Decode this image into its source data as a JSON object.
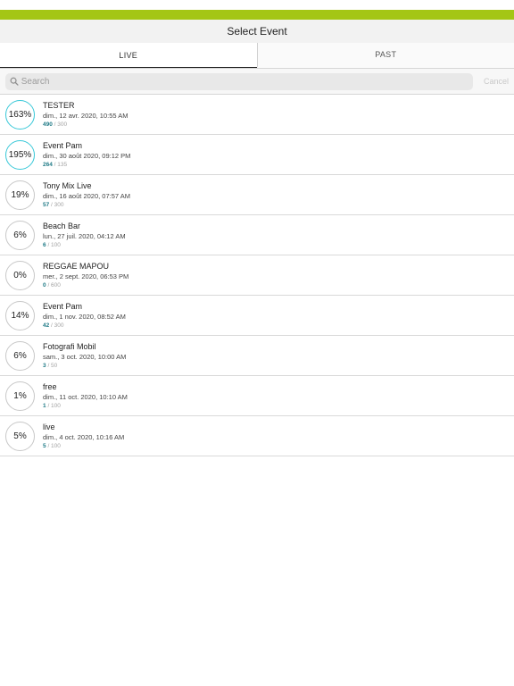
{
  "colors": {
    "accent": "#a4c615",
    "full_ring": "#38c8d8",
    "sold": "#1f7a86"
  },
  "header": {
    "title": "Select Event"
  },
  "tabs": [
    {
      "label": "LIVE",
      "active": true
    },
    {
      "label": "PAST",
      "active": false
    }
  ],
  "search": {
    "placeholder": "Search",
    "value": "",
    "cancel_label": "Cancel",
    "icon": "search-icon"
  },
  "events": [
    {
      "percent": "163%",
      "name": "TESTER",
      "date": "dim., 12 avr. 2020, 10:55 AM",
      "sold": "490",
      "capacity": "/ 300",
      "over": true
    },
    {
      "percent": "195%",
      "name": "Event Pam",
      "date": "dim., 30 août 2020, 09:12 PM",
      "sold": "264",
      "capacity": "/ 135",
      "over": true
    },
    {
      "percent": "19%",
      "name": "Tony Mix Live",
      "date": "dim., 16 août 2020, 07:57 AM",
      "sold": "57",
      "capacity": "/ 300",
      "over": false
    },
    {
      "percent": "6%",
      "name": "Beach Bar",
      "date": "lun., 27 juil. 2020, 04:12 AM",
      "sold": "6",
      "capacity": "/ 100",
      "over": false
    },
    {
      "percent": "0%",
      "name": "REGGAE MAPOU",
      "date": "mer., 2 sept. 2020, 06:53 PM",
      "sold": "0",
      "capacity": "/ 600",
      "over": false
    },
    {
      "percent": "14%",
      "name": "Event Pam",
      "date": "dim., 1 nov. 2020, 08:52 AM",
      "sold": "42",
      "capacity": "/ 300",
      "over": false
    },
    {
      "percent": "6%",
      "name": "Fotografi Mobil",
      "date": "sam., 3 oct. 2020, 10:00 AM",
      "sold": "3",
      "capacity": "/ 50",
      "over": false
    },
    {
      "percent": "1%",
      "name": "free",
      "date": "dim., 11 oct. 2020, 10:10 AM",
      "sold": "1",
      "capacity": "/ 100",
      "over": false
    },
    {
      "percent": "5%",
      "name": "live",
      "date": "dim., 4 oct. 2020, 10:16 AM",
      "sold": "5",
      "capacity": "/ 100",
      "over": false
    }
  ]
}
